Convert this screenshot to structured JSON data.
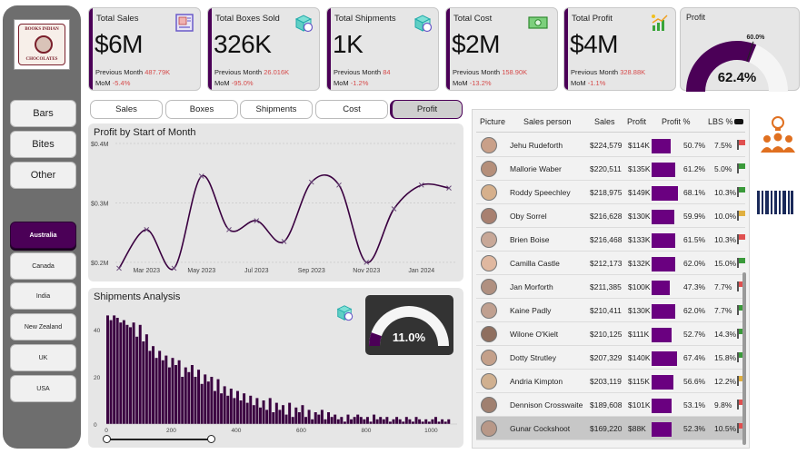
{
  "logo": {
    "top_text": "BOOKS INDIAN",
    "bottom_text": "CHOCOLATES"
  },
  "categories": [
    "Bars",
    "Bites",
    "Other"
  ],
  "countries": [
    {
      "label": "Australia",
      "active": true
    },
    {
      "label": "Canada",
      "active": false
    },
    {
      "label": "India",
      "active": false
    },
    {
      "label": "New Zealand",
      "active": false
    },
    {
      "label": "UK",
      "active": false
    },
    {
      "label": "USA",
      "active": false
    }
  ],
  "kpis": [
    {
      "title": "Total Sales",
      "value": "$6M",
      "prev_label": "Previous Month",
      "prev_value": "487.79K",
      "mom_label": "MoM",
      "mom_value": "-5.4%",
      "icon": "receipt-icon"
    },
    {
      "title": "Total Boxes Sold",
      "value": "326K",
      "prev_label": "Previous Month",
      "prev_value": "26.016K",
      "mom_label": "MoM",
      "mom_value": "-95.0%",
      "icon": "box-icon"
    },
    {
      "title": "Total Shipments",
      "value": "1K",
      "prev_label": "Previous Month",
      "prev_value": "84",
      "mom_label": "MoM",
      "mom_value": "-1.2%",
      "icon": "shipment-box-icon"
    },
    {
      "title": "Total Cost",
      "value": "$2M",
      "prev_label": "Previous Month",
      "prev_value": "158.90K",
      "mom_label": "MoM",
      "mom_value": "-13.2%",
      "icon": "money-icon"
    },
    {
      "title": "Total Profit",
      "value": "$4M",
      "prev_label": "Previous Month",
      "prev_value": "328.88K",
      "mom_label": "MoM",
      "mom_value": "-1.1%",
      "icon": "growth-chart-icon"
    }
  ],
  "profit_gauge": {
    "title": "Profit",
    "value_label": "62.4%",
    "target_label": "60.0%",
    "value": 0.624,
    "target": 0.6,
    "fill_color": "#4b0057",
    "track_color": "#f5f5f5"
  },
  "tabs": [
    {
      "label": "Sales",
      "active": false
    },
    {
      "label": "Boxes",
      "active": false
    },
    {
      "label": "Shipments",
      "active": false
    },
    {
      "label": "Cost",
      "active": false
    },
    {
      "label": "Profit",
      "active": true
    }
  ],
  "accent_color": "#4b0057",
  "shipment_gauge": {
    "value_label": "11.0%",
    "value": 0.11
  },
  "chart_data": [
    {
      "type": "line",
      "title": "Profit by Start of Month",
      "x": [
        "2023-02",
        "2023-03",
        "2023-04",
        "2023-05",
        "2023-06",
        "2023-07",
        "2023-08",
        "2023-09",
        "2023-10",
        "2023-11",
        "2023-12",
        "2024-01",
        "2024-02"
      ],
      "x_tick_labels": [
        "Mar 2023",
        "May 2023",
        "Jul 2023",
        "Sep 2023",
        "Nov 2023",
        "Jan 2024"
      ],
      "x_tick_positions": [
        "2023-03",
        "2023-05",
        "2023-07",
        "2023-09",
        "2023-11",
        "2024-01"
      ],
      "y_tick_labels": [
        "$0.2M",
        "$0.3M",
        "$0.4M"
      ],
      "y_tick_values": [
        0.2,
        0.3,
        0.4
      ],
      "values": [
        0.19,
        0.255,
        0.19,
        0.345,
        0.255,
        0.27,
        0.235,
        0.335,
        0.33,
        0.2,
        0.29,
        0.33,
        0.325
      ],
      "ylim": [
        0.18,
        0.4
      ],
      "color": "#3a0040"
    },
    {
      "type": "bar",
      "title": "Shipments Analysis",
      "x_tick_labels": [
        "0",
        "200",
        "400",
        "600",
        "800",
        "1000"
      ],
      "x_tick_values": [
        0,
        200,
        400,
        600,
        800,
        1000
      ],
      "y_tick_labels": [
        "0",
        "20",
        "40"
      ],
      "y_tick_values": [
        0,
        20,
        40
      ],
      "xlim": [
        0,
        1080
      ],
      "ylim": [
        0,
        50
      ],
      "bin_width": 10,
      "values": [
        46,
        44,
        46,
        45,
        43,
        44,
        42,
        41,
        43,
        37,
        42,
        35,
        38,
        31,
        33,
        28,
        31,
        27,
        29,
        24,
        28,
        25,
        27,
        20,
        24,
        22,
        25,
        20,
        23,
        17,
        21,
        18,
        20,
        14,
        19,
        13,
        16,
        12,
        15,
        11,
        14,
        10,
        13,
        9,
        12,
        8,
        11,
        7,
        10,
        6,
        11,
        5,
        9,
        6,
        8,
        4,
        9,
        3,
        7,
        5,
        8,
        3,
        6,
        2,
        5,
        4,
        6,
        2,
        5,
        3,
        4,
        2,
        3,
        1,
        4,
        2,
        3,
        4,
        3,
        2,
        3,
        1,
        4,
        2,
        3,
        2,
        3,
        1,
        2,
        3,
        2,
        1,
        3,
        2,
        1,
        3,
        2,
        1,
        2,
        1,
        2,
        3,
        1,
        2,
        1,
        2
      ],
      "color": "#3a0040"
    }
  ],
  "table": {
    "headers": [
      "Picture",
      "Sales person",
      "Sales",
      "Profit",
      "Profit %",
      "LBS %"
    ],
    "rows": [
      {
        "name": "Jehu Rudeforth",
        "sales": "$224,579",
        "profit": "$114K",
        "profit_pct": "50.7%",
        "lbs": "7.5%",
        "pct": 0.507,
        "flag": "#e05050"
      },
      {
        "name": "Mallorie Waber",
        "sales": "$220,511",
        "profit": "$135K",
        "profit_pct": "61.2%",
        "lbs": "5.0%",
        "pct": 0.612,
        "flag": "#3a9a3a"
      },
      {
        "name": "Roddy Speechley",
        "sales": "$218,975",
        "profit": "$149K",
        "profit_pct": "68.1%",
        "lbs": "10.3%",
        "pct": 0.681,
        "flag": "#3a9a3a"
      },
      {
        "name": "Oby Sorrel",
        "sales": "$216,628",
        "profit": "$130K",
        "profit_pct": "59.9%",
        "lbs": "10.0%",
        "pct": 0.599,
        "flag": "#e0b040"
      },
      {
        "name": "Brien Boise",
        "sales": "$216,468",
        "profit": "$133K",
        "profit_pct": "61.5%",
        "lbs": "10.3%",
        "pct": 0.615,
        "flag": "#e05050"
      },
      {
        "name": "Camilla Castle",
        "sales": "$212,173",
        "profit": "$132K",
        "profit_pct": "62.0%",
        "lbs": "15.0%",
        "pct": 0.62,
        "flag": "#3a9a3a"
      },
      {
        "name": "Jan Morforth",
        "sales": "$211,385",
        "profit": "$100K",
        "profit_pct": "47.3%",
        "lbs": "7.7%",
        "pct": 0.473,
        "flag": "#e05050"
      },
      {
        "name": "Kaine Padly",
        "sales": "$210,411",
        "profit": "$130K",
        "profit_pct": "62.0%",
        "lbs": "7.7%",
        "pct": 0.62,
        "flag": "#3a9a3a"
      },
      {
        "name": "Wilone O'Kielt",
        "sales": "$210,125",
        "profit": "$111K",
        "profit_pct": "52.7%",
        "lbs": "14.3%",
        "pct": 0.527,
        "flag": "#3a9a3a"
      },
      {
        "name": "Dotty Strutley",
        "sales": "$207,329",
        "profit": "$140K",
        "profit_pct": "67.4%",
        "lbs": "15.8%",
        "pct": 0.674,
        "flag": "#3a9a3a"
      },
      {
        "name": "Andria Kimpton",
        "sales": "$203,119",
        "profit": "$115K",
        "profit_pct": "56.6%",
        "lbs": "12.2%",
        "pct": 0.566,
        "flag": "#e0b040"
      },
      {
        "name": "Dennison Crosswaite",
        "sales": "$189,608",
        "profit": "$101K",
        "profit_pct": "53.1%",
        "lbs": "9.8%",
        "pct": 0.531,
        "flag": "#e05050"
      },
      {
        "name": "Gunar Cockshoot",
        "sales": "$169,220",
        "profit": "$88K",
        "profit_pct": "52.3%",
        "lbs": "10.5%",
        "pct": 0.523,
        "flag": "#e05050",
        "selected": true
      }
    ]
  },
  "side_icons": [
    "ideas-team-icon",
    "barcode-icon"
  ]
}
